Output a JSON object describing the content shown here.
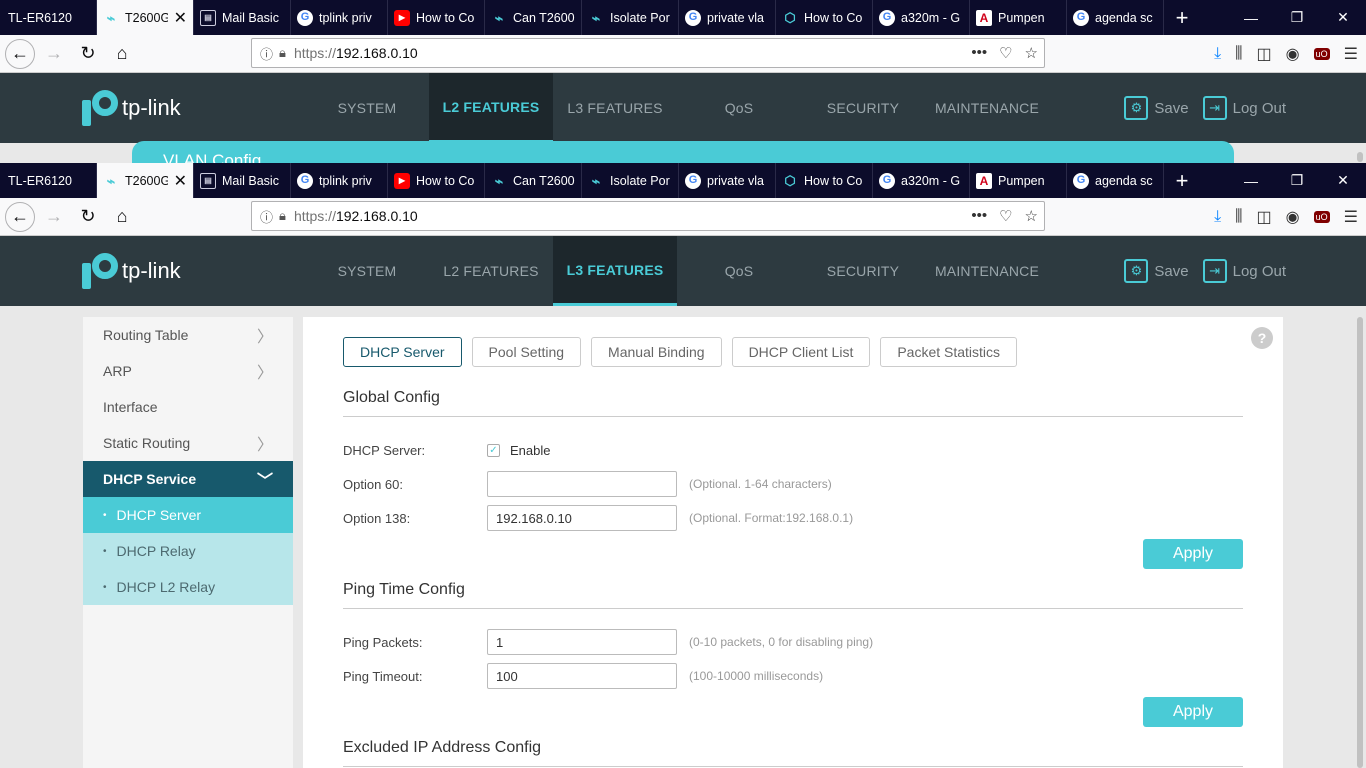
{
  "browser_tabs": [
    {
      "label": "TL-ER6120",
      "icon": "none",
      "active": false
    },
    {
      "label": "T2600G",
      "icon": "tplink",
      "active": true
    },
    {
      "label": "Mail Basic",
      "icon": "mail",
      "active": false
    },
    {
      "label": "tplink priv",
      "icon": "google",
      "active": false
    },
    {
      "label": "How to Co",
      "icon": "youtube",
      "active": false
    },
    {
      "label": "Can T2600",
      "icon": "tplink",
      "active": false
    },
    {
      "label": "Isolate Por",
      "icon": "tplink",
      "active": false
    },
    {
      "label": "private vla",
      "icon": "google",
      "active": false
    },
    {
      "label": "How to Co",
      "icon": "shield",
      "active": false
    },
    {
      "label": "a320m - G",
      "icon": "google",
      "active": false
    },
    {
      "label": "Pumpen",
      "icon": "acrobat",
      "active": false
    },
    {
      "label": "agenda sc",
      "icon": "google",
      "active": false
    }
  ],
  "url": {
    "protocol": "https://",
    "host": "192.168.0.10"
  },
  "tp_header": {
    "logo": "tp-link",
    "nav": [
      "SYSTEM",
      "L2 FEATURES",
      "L3 FEATURES",
      "QoS",
      "SECURITY",
      "MAINTENANCE"
    ],
    "save": "Save",
    "logout": "Log Out"
  },
  "background_window": {
    "active_nav": "L2 FEATURES",
    "banner_title": "VLAN Config"
  },
  "foreground_window": {
    "active_nav": "L3 FEATURES"
  },
  "sidebar": {
    "items": [
      {
        "label": "Routing Table",
        "has_chevron": true
      },
      {
        "label": "ARP",
        "has_chevron": true
      },
      {
        "label": "Interface",
        "has_chevron": false
      },
      {
        "label": "Static Routing",
        "has_chevron": true
      }
    ],
    "open_group": "DHCP Service",
    "sub_items": [
      {
        "label": "DHCP Server",
        "active": true
      },
      {
        "label": "DHCP Relay",
        "active": false
      },
      {
        "label": "DHCP L2 Relay",
        "active": false
      }
    ]
  },
  "subtabs": [
    "DHCP Server",
    "Pool Setting",
    "Manual Binding",
    "DHCP Client List",
    "Packet Statistics"
  ],
  "global_config": {
    "title": "Global Config",
    "dhcp_server_label": "DHCP Server:",
    "enable_label": "Enable",
    "enable_checked": true,
    "option60_label": "Option 60:",
    "option60_value": "",
    "option60_hint": "(Optional. 1-64 characters)",
    "option138_label": "Option 138:",
    "option138_value": "192.168.0.10",
    "option138_hint": "(Optional. Format:192.168.0.1)",
    "apply": "Apply"
  },
  "ping_config": {
    "title": "Ping Time Config",
    "packets_label": "Ping Packets:",
    "packets_value": "1",
    "packets_hint": "(0-10 packets, 0 for disabling ping)",
    "timeout_label": "Ping Timeout:",
    "timeout_value": "100",
    "timeout_hint": "(100-10000 milliseconds)",
    "apply": "Apply"
  },
  "excluded_config": {
    "title": "Excluded IP Address Config"
  },
  "colors": {
    "accent": "#4acbd6",
    "header_bg": "#2d3a40",
    "sidebar_open": "#17596c"
  }
}
